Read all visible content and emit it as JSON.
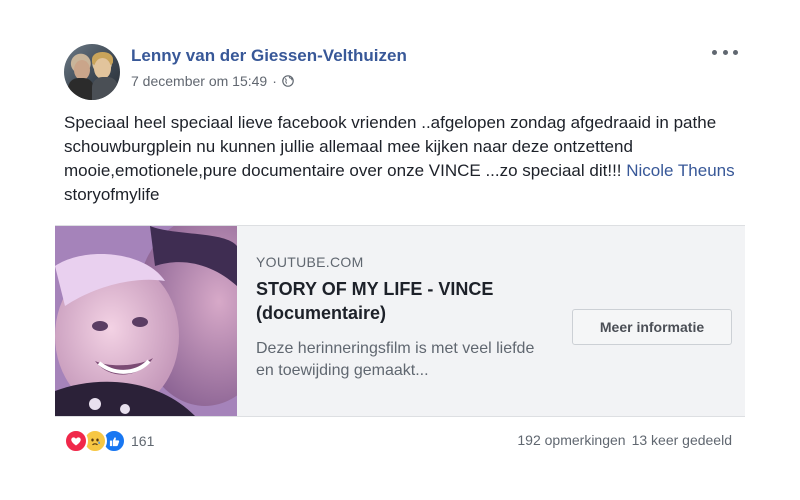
{
  "post": {
    "author": "Lenny van der Giessen-Velthuizen",
    "timestamp": "7 december om 15:49",
    "separator": "·",
    "privacy_icon": "globe-icon",
    "menu_icon": "more-options-icon",
    "text_before_link": "Speciaal heel speciaal lieve facebook vrienden ..afgelopen zondag afgedraaid in pathe schouwburgplein nu kunnen jullie allemaal mee kijken naar deze ontzettend mooie,emotionele,pure documentaire over onze VINCE ...zo speciaal dit!!! ",
    "mention": "Nicole Theuns",
    "text_after_link": " storyofmylife"
  },
  "link_card": {
    "domain": "YOUTUBE.COM",
    "title": "STORY OF MY LIFE - VINCE (documentaire)",
    "description": "Deze herinneringsfilm is met veel liefde en toewijding gemaakt...",
    "cta_label": "Meer informatie"
  },
  "footer": {
    "reactions": [
      "love-reaction-icon",
      "sad-reaction-icon",
      "like-reaction-icon"
    ],
    "reaction_count": "161",
    "comments": "192 opmerkingen",
    "shares": "13 keer gedeeld"
  },
  "colors": {
    "link": "#385898",
    "love": "#f0284a",
    "sad": "#f7c744",
    "like": "#1877f2"
  }
}
